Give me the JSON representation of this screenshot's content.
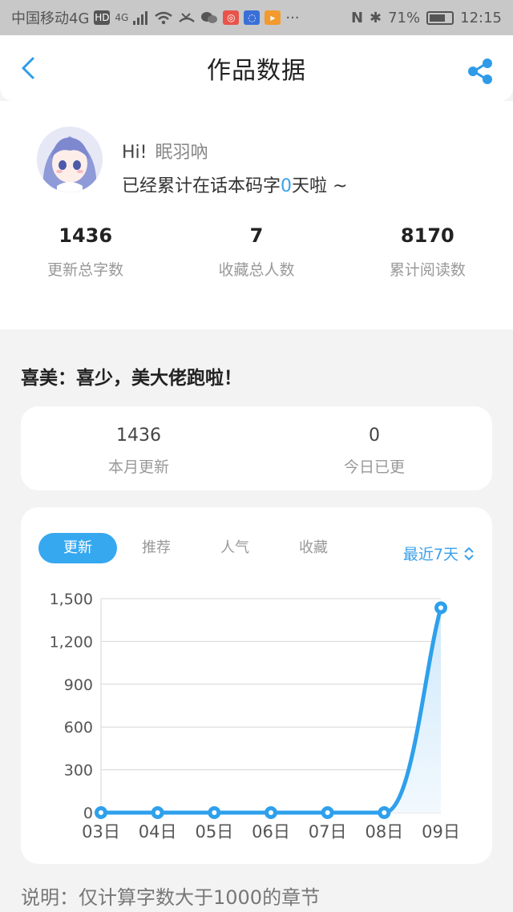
{
  "status_bar": {
    "carrier": "中国移动4G",
    "hd": "HD",
    "net": "4G",
    "more": "···",
    "battery_pct": "71%",
    "battery_level": 0.71,
    "time": "12:15"
  },
  "header": {
    "title": "作品数据",
    "back_icon": "chevron-left-icon",
    "share_icon": "share-icon"
  },
  "profile": {
    "greeting": "Hi!",
    "nickname": "眠羽吶",
    "days_prefix": "已经累计在话本码字",
    "days_value": "0",
    "days_suffix": "天啦 ~",
    "stats": [
      {
        "value": "1436",
        "label": "更新总字数"
      },
      {
        "value": "7",
        "label": "收藏总人数"
      },
      {
        "value": "8170",
        "label": "累计阅读数"
      }
    ]
  },
  "section_title": "喜美：喜少，美大佬跑啦！",
  "monthly": [
    {
      "value": "1436",
      "label": "本月更新"
    },
    {
      "value": "0",
      "label": "今日已更"
    }
  ],
  "tabs": [
    {
      "label": "更新",
      "active": true
    },
    {
      "label": "推荐",
      "active": false
    },
    {
      "label": "人气",
      "active": false
    },
    {
      "label": "收藏",
      "active": false
    }
  ],
  "range": {
    "label": "最近7天",
    "icon": "up-down-chevron-icon"
  },
  "chart_data": {
    "type": "area",
    "categories": [
      "03日",
      "04日",
      "05日",
      "06日",
      "07日",
      "08日",
      "09日"
    ],
    "values": [
      0,
      0,
      0,
      0,
      0,
      0,
      1436
    ],
    "yticks": [
      "0",
      "300",
      "600",
      "900",
      "1,200",
      "1,500"
    ],
    "ylim": [
      0,
      1500
    ],
    "grid": true,
    "line_color": "#2ea0ec",
    "fill_color": "#cfe8fa"
  },
  "note": "说明：仅计算字数大于1000的章节",
  "colors": {
    "accent": "#3aa0ea"
  }
}
